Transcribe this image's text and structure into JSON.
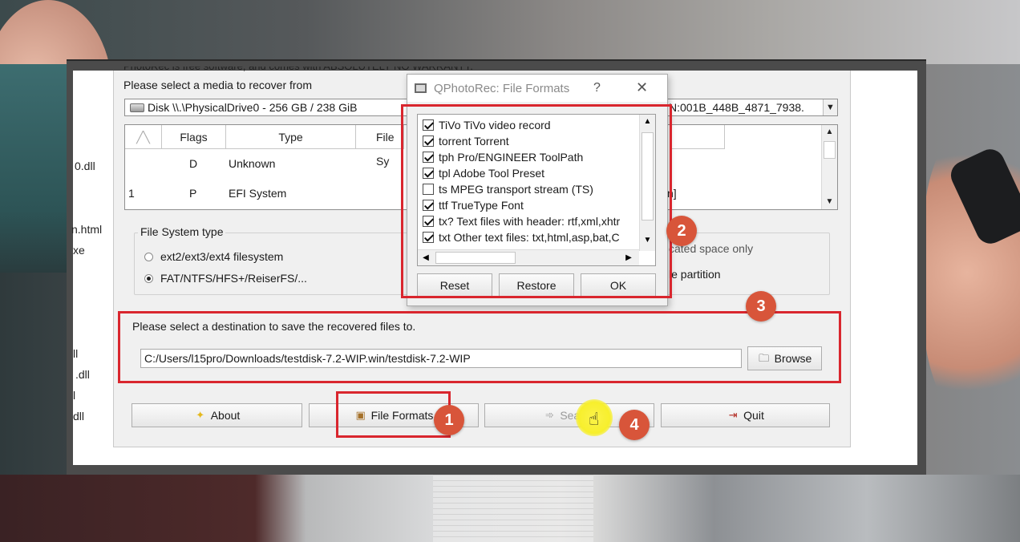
{
  "main": {
    "cut_top_text": "PhotoRec is free software, and comes with ABSOLUTELY NO WARRANTY.",
    "media_prompt": "Please select a media to recover from",
    "disk_combo_value": "Disk \\\\.\\PhysicalDrive0 - 256 GB / 238 GiB",
    "disk_combo_tail": "N:001B_448B_4871_7938.",
    "table": {
      "columns": [
        "",
        "Flags",
        "Type",
        "File Sy"
      ],
      "rows": [
        {
          "num": "",
          "flags": "D",
          "type": "Unknown",
          "tail": ""
        },
        {
          "num": "1",
          "flags": "P",
          "type": "EFI System",
          "tail": "n]"
        }
      ]
    },
    "fs_group_title": "File System type",
    "fs_options": [
      {
        "label": "ext2/ext3/ext4 filesystem",
        "selected": false
      },
      {
        "label": "FAT/NTFS/HFS+/ReiserFS/...",
        "selected": true
      }
    ],
    "right_opt1_tail": "cated space only",
    "right_opt2_tail": "le partition",
    "dest_prompt": "Please select a destination to save the recovered files to.",
    "dest_path": "C:/Users/l15pro/Downloads/testdisk-7.2-WIP.win/testdisk-7.2-WIP",
    "browse_label": "Browse",
    "buttons": {
      "about": "About",
      "file_formats": "File Formats",
      "search": "Search",
      "quit": "Quit"
    }
  },
  "dialog": {
    "title": "QPhotoRec: File Formats",
    "help": "?",
    "close": "✕",
    "items": [
      {
        "label": "TiVo TiVo video record",
        "checked": true
      },
      {
        "label": "torrent Torrent",
        "checked": true
      },
      {
        "label": "tph  Pro/ENGINEER ToolPath",
        "checked": true
      },
      {
        "label": "tpl  Adobe Tool Preset",
        "checked": true
      },
      {
        "label": "ts   MPEG transport stream (TS)",
        "checked": false
      },
      {
        "label": "ttf  TrueType Font",
        "checked": true
      },
      {
        "label": "tx?  Text files with header: rtf,xml,xhtr",
        "checked": true
      },
      {
        "label": "txt  Other text files: txt,html,asp,bat,C",
        "checked": true
      }
    ],
    "reset": "Reset",
    "restore": "Restore",
    "ok": "OK"
  },
  "desktop_fragments": [
    "0.dll",
    "n.html",
    "xe",
    "ll",
    ".dll",
    "l",
    "dll"
  ],
  "annotations": [
    "1",
    "2",
    "3",
    "4"
  ],
  "colors": {
    "highlight": "#d9262e",
    "step_badge": "#d8553a",
    "cursor_glow": "#f7ef2c"
  }
}
